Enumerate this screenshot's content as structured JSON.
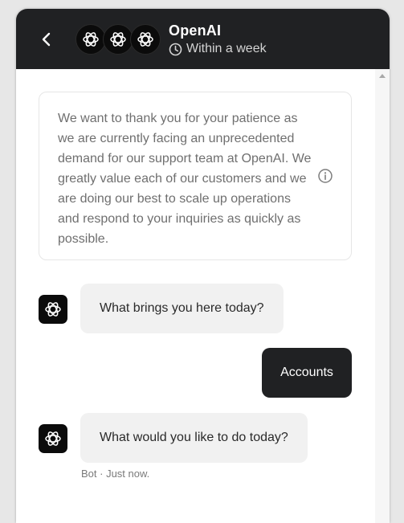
{
  "header": {
    "title": "OpenAI",
    "response_time": "Within a week",
    "avatar_icon": "openai-logo-icon",
    "back_icon": "chevron-left-icon",
    "background": "#202123"
  },
  "notice": {
    "text": "We want to thank you for your patience as we are currently facing an unprecedented demand for our support team at OpenAI. We greatly value each of our customers and we are doing our best to scale up operations and respond to your inquiries as quickly as possible.",
    "icon": "info-icon"
  },
  "messages": [
    {
      "from": "bot",
      "text": "What brings you here today?"
    },
    {
      "from": "user",
      "text": "Accounts"
    },
    {
      "from": "bot",
      "text": "What would you like to do today?"
    }
  ],
  "last_message_meta": "Bot · Just now."
}
